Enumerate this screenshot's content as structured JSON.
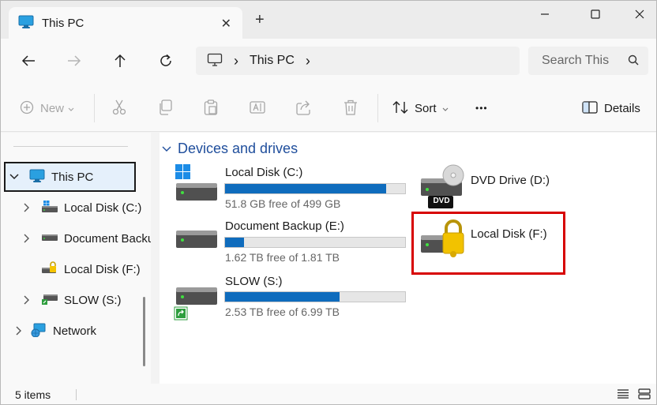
{
  "tab": {
    "title": "This PC",
    "close_glyph": "✕",
    "new_tab_glyph": "+"
  },
  "window_controls": {
    "min": "minimize-icon",
    "max": "maximize-icon",
    "close": "close-icon"
  },
  "nav": {
    "back": "arrow-left-icon",
    "forward": "arrow-right-icon",
    "up": "arrow-up-icon",
    "refresh": "refresh-icon"
  },
  "address": {
    "location": "This PC",
    "separator": "›"
  },
  "search": {
    "placeholder": "Search This"
  },
  "commands": {
    "new_label": "New",
    "sort_label": "Sort",
    "more_glyph": "•••",
    "details_label": "Details"
  },
  "sidebar": {
    "items": [
      {
        "label": "This PC",
        "icon": "monitor-icon",
        "expanded": true,
        "selected": true
      },
      {
        "label": "Local Disk (C:)",
        "icon": "windows-drive-icon"
      },
      {
        "label": "Document Backup (E:)",
        "icon": "drive-icon"
      },
      {
        "label": "Local Disk (F:)",
        "icon": "locked-drive-icon"
      },
      {
        "label": "SLOW (S:)",
        "icon": "network-share-icon"
      },
      {
        "label": "Network",
        "icon": "network-icon"
      }
    ]
  },
  "main": {
    "group_title": "Devices and drives",
    "drives": [
      {
        "name": "Local Disk (C:)",
        "free_text": "51.8 GB free of 499 GB",
        "used_fraction": 0.896,
        "icon": "windows-drive-icon"
      },
      {
        "name": "DVD Drive (D:)",
        "icon": "dvd-drive-icon",
        "badge": "DVD"
      },
      {
        "name": "Document Backup (E:)",
        "free_text": "1.62 TB free of 1.81 TB",
        "used_fraction": 0.105,
        "icon": "drive-icon"
      },
      {
        "name": "Local Disk (F:)",
        "icon": "locked-drive-icon",
        "highlighted": true
      },
      {
        "name": "SLOW (S:)",
        "free_text": "2.53 TB free of 6.99 TB",
        "used_fraction": 0.638,
        "icon": "network-share-icon"
      }
    ]
  },
  "status": {
    "items_text": "5 items"
  },
  "colors": {
    "accent": "#0f6cbd",
    "highlight": "#d70000",
    "group_title": "#1f4e9c"
  }
}
